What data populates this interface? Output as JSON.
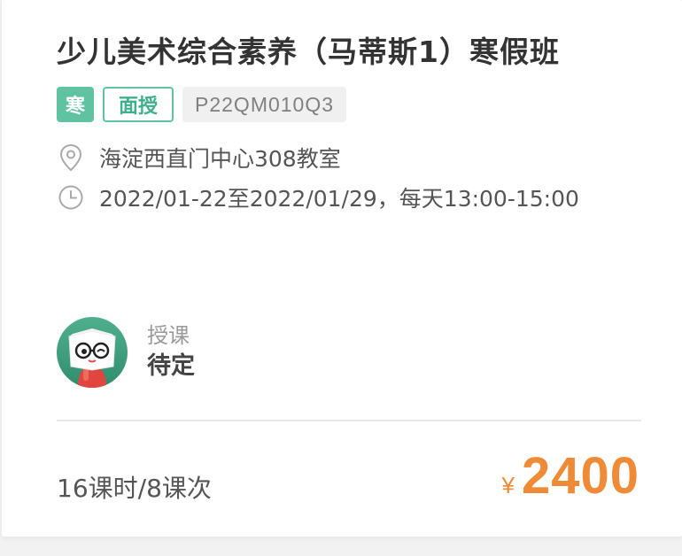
{
  "course": {
    "title": "少儿美术综合素养（马蒂斯1）寒假班",
    "tags": {
      "season": "寒",
      "mode": "面授",
      "code": "P22QM010Q3"
    },
    "location": "海淀西直门中心308教室",
    "schedule": "2022/01-22至2022/01/29，每天13:00-15:00",
    "location_icon": "location-pin-icon",
    "time_icon": "clock-icon"
  },
  "teacher": {
    "role": "授课",
    "name": "待定"
  },
  "footer": {
    "lessons": "16课时/8课次",
    "currency": "¥",
    "price": "2400"
  },
  "colors": {
    "accent_green": "#5fc3a2",
    "price_orange": "#ef8a37"
  }
}
